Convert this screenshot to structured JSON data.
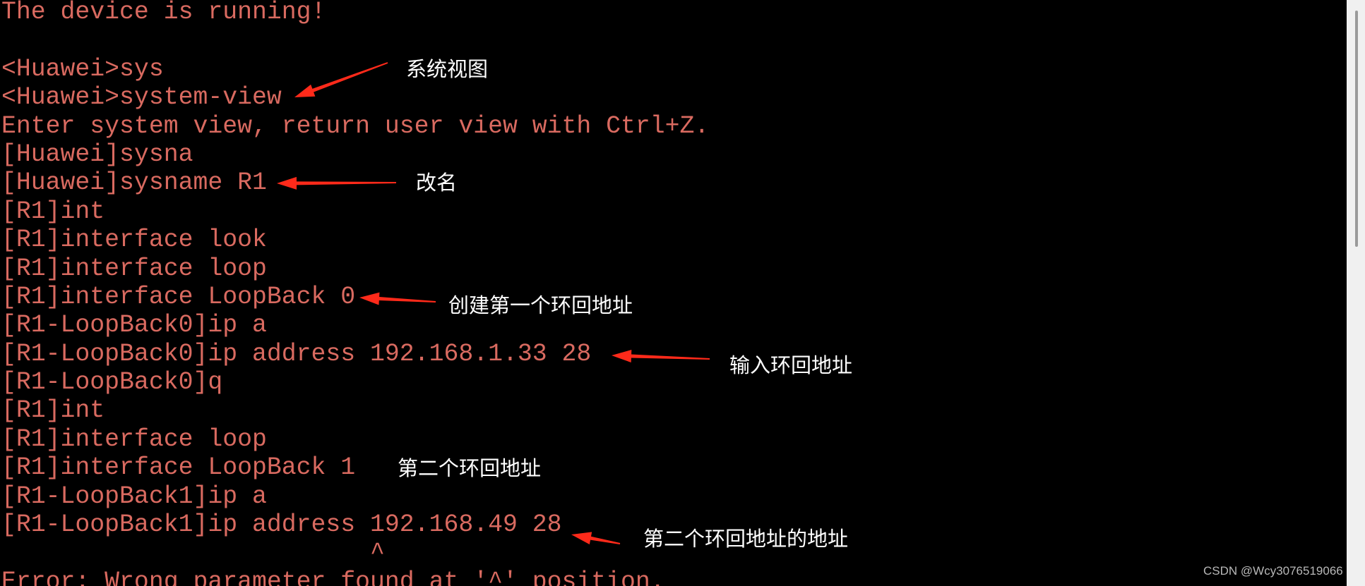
{
  "terminal": {
    "text_color": "#d96a60",
    "background": "#000000",
    "lines": [
      "The device is running!",
      "",
      "<Huawei>sys",
      "<Huawei>system-view",
      "Enter system view, return user view with Ctrl+Z.",
      "[Huawei]sysna",
      "[Huawei]sysname R1",
      "[R1]int",
      "[R1]interface look",
      "[R1]interface loop",
      "[R1]interface LoopBack 0",
      "[R1-LoopBack0]ip a",
      "[R1-LoopBack0]ip address 192.168.1.33 28",
      "[R1-LoopBack0]q",
      "[R1]int",
      "[R1]interface loop",
      "[R1]interface LoopBack 1",
      "[R1-LoopBack1]ip a",
      "[R1-LoopBack1]ip address 192.168.49 28",
      "                         ^",
      "Error: Wrong parameter found at '^' position."
    ]
  },
  "annotations": {
    "system_view": "系统视图",
    "rename": "改名",
    "create_first_loopback": "创建第一个环回地址",
    "enter_loopback_address": "输入环回地址",
    "second_loopback": "第二个环回地址",
    "second_loopback_address": "第二个环回地址的地址",
    "arrow_color": "#ff2a1a"
  },
  "watermark": "CSDN @Wcy3076519066"
}
